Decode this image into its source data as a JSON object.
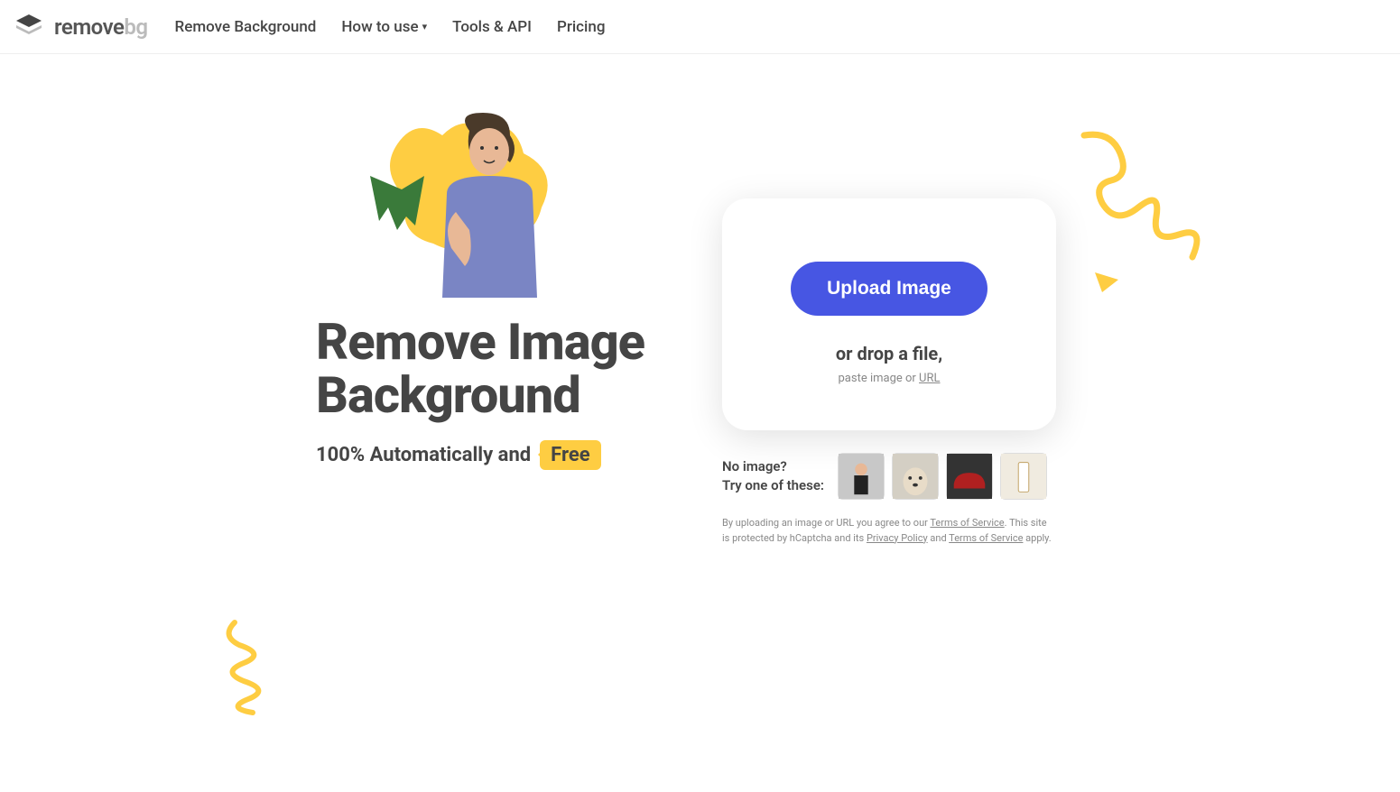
{
  "logo": {
    "remove": "remove",
    "bg": "bg"
  },
  "nav": {
    "remove_background": "Remove Background",
    "how_to_use": "How to use",
    "tools_api": "Tools & API",
    "pricing": "Pricing"
  },
  "hero": {
    "title": "Remove Image Background",
    "subtitle_prefix": "100% Automatically and",
    "free_badge": "Free"
  },
  "upload": {
    "button": "Upload Image",
    "drop": "or drop a file,",
    "paste_prefix": "paste image or ",
    "url": "URL"
  },
  "samples": {
    "line1": "No image?",
    "line2": "Try one of these:",
    "thumbs": [
      "sample-person",
      "sample-dog",
      "sample-car",
      "sample-product"
    ]
  },
  "legal": {
    "text1": "By uploading an image or URL you agree to our ",
    "tos": "Terms of Service",
    "text2": ". This site is protected by hCaptcha and its ",
    "privacy": "Privacy Policy",
    "text3": " and ",
    "tos2": "Terms of Service",
    "text4": " apply."
  },
  "colors": {
    "accent_yellow": "#fecd42",
    "accent_blue": "#4756e3"
  }
}
